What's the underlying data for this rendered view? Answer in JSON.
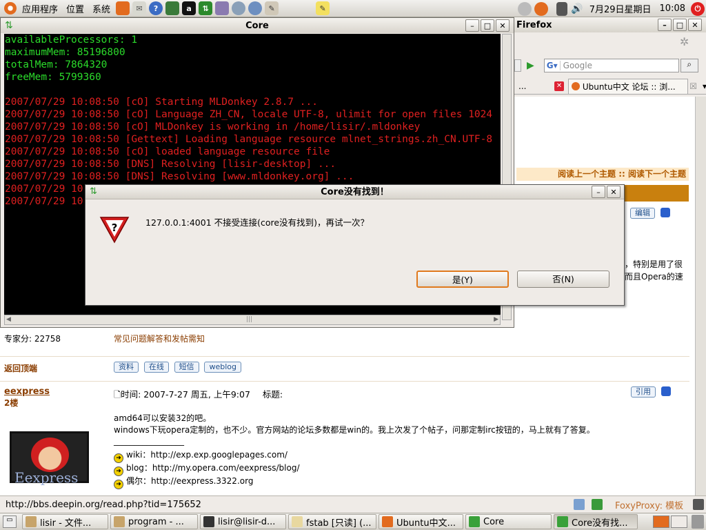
{
  "top_panel": {
    "menus": [
      "应用程序",
      "位置",
      "系统"
    ],
    "date": "7月29日星期日",
    "time": "10:08"
  },
  "firefox": {
    "title": "Firefox",
    "search_placeholder": "Google",
    "tab_partial": "...",
    "tab_label": "Ubuntu中文 论坛 :: 浏...",
    "nav_header": "阅读上一个主题 :: 阅读下一个主题",
    "edit_btn": "编辑",
    "snippet1": "，特别是用了很",
    "snippet2": "而且Opera的速",
    "status_url": "http://bbs.deepin.org/read.php?tid=175652",
    "foxyproxy": "FoxyProxy: 模板"
  },
  "forum": {
    "expert_score": "专家分: 22758",
    "faq_link": "常见问题解答和发帖需知",
    "back_top": "返回顶端",
    "buttons": [
      "资料",
      "在线",
      "短信",
      "weblog"
    ],
    "quote_btn": "引用",
    "username": "eexpress",
    "floor": "2楼",
    "post_time": "时间: 2007-7-27 周五, 上午9:07",
    "post_title_label": "标题:",
    "line1": "amd64可以安装32的吧。",
    "line2": "windows下玩opera定制的，也不少。官方网站的论坛多数都是win的。我上次发了个帖子，问那定制irc按钮的，马上就有了答复。",
    "sig_divider": "_________________",
    "sig1": "wiki：http://exp.exp.googlepages.com/",
    "sig2": "blog：http://my.opera.com/eexpress/blog/",
    "sig3": "偶尔：http://eexpress.3322.org",
    "avatar_text": "Eexpress"
  },
  "core": {
    "title": "Core",
    "lines": [
      {
        "text": "availableProcessors: 1",
        "color": "green"
      },
      {
        "text": "maximumMem: 85196800",
        "color": "green"
      },
      {
        "text": "totalMem: 7864320",
        "color": "green"
      },
      {
        "text": "freeMem: 5799360",
        "color": "green"
      },
      {
        "text": "",
        "color": "green"
      },
      {
        "text": "2007/07/29 10:08:50 [cO] Starting MLDonkey 2.8.7 ...",
        "color": "red"
      },
      {
        "text": "2007/07/29 10:08:50 [cO] Language ZH_CN, locale UTF-8, ulimit for open files 1024",
        "color": "red"
      },
      {
        "text": "2007/07/29 10:08:50 [cO] MLDonkey is working in /home/lisir/.mldonkey",
        "color": "red"
      },
      {
        "text": "2007/07/29 10:08:50 [Gettext] Loading language resource mlnet_strings.zh_CN.UTF-8",
        "color": "red"
      },
      {
        "text": "2007/07/29 10:08:50 [cO] loaded language resource file",
        "color": "red"
      },
      {
        "text": "2007/07/29 10:08:50 [DNS] Resolving [lisir-desktop] ...",
        "color": "red"
      },
      {
        "text": "2007/07/29 10:08:50 [DNS] Resolving [www.mldonkey.org] ...",
        "color": "red"
      },
      {
        "text": "2007/07/29 10",
        "color": "red"
      },
      {
        "text": "2007/07/29 10",
        "color": "red"
      }
    ]
  },
  "dialog": {
    "title": "Core没有找到！",
    "message": "127.0.0.1:4001 不接受连接(core没有找到)，再试一次？",
    "yes": "是(Y)",
    "no": "否(N)"
  },
  "taskbar": {
    "tasks": [
      {
        "label": "lisir - 文件...",
        "color": "#c7a46a"
      },
      {
        "label": "program - ...",
        "color": "#c7a46a"
      },
      {
        "label": "lisir@lisir-d...",
        "color": "#333333"
      },
      {
        "label": "fstab [只读] (...",
        "color": "#e8d8a0"
      },
      {
        "label": "Ubuntu中文...",
        "color": "#e26b1f"
      },
      {
        "label": "Core",
        "color": "#3aa13a"
      },
      {
        "label": "Core没有找...",
        "color": "#3aa13a"
      }
    ]
  },
  "colors": {
    "console_bg": "#000000",
    "console_green": "#2bdc2b",
    "console_red": "#e02020",
    "accent_orange": "#e0791c"
  }
}
